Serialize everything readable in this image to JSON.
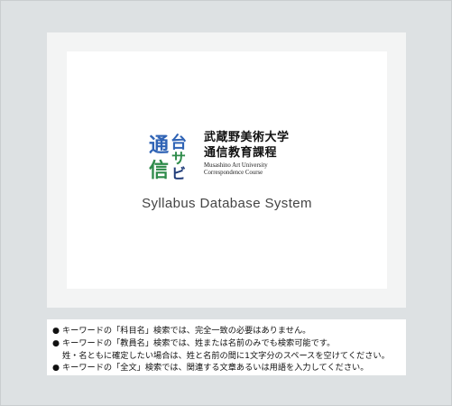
{
  "logo": {
    "mark_chars": [
      "通",
      "信",
      "台",
      "サ",
      "ビ"
    ],
    "name_line1": "武蔵野美術大学",
    "name_line2": "通信教育課程",
    "english_line1": "Musashino Art University",
    "english_line2": "Correspondence Course",
    "colors": {
      "blue": "#2f63b5",
      "green": "#2e8b4a",
      "navy": "#1e3a78"
    }
  },
  "system_title": "Syllabus Database System",
  "notes": {
    "bullet": "●",
    "line1": "キーワードの「科目名」検索では、完全一致の必要はありません。",
    "line2": "キーワードの「教員名」検索では、姓または名前のみでも検索可能です。",
    "line3": "姓・名ともに確定したい場合は、姓と名前の間に1文字分のスペースを空けてください。",
    "line4": "キーワードの「全文」検索では、関連する文章あるいは用語を入力してください。"
  }
}
